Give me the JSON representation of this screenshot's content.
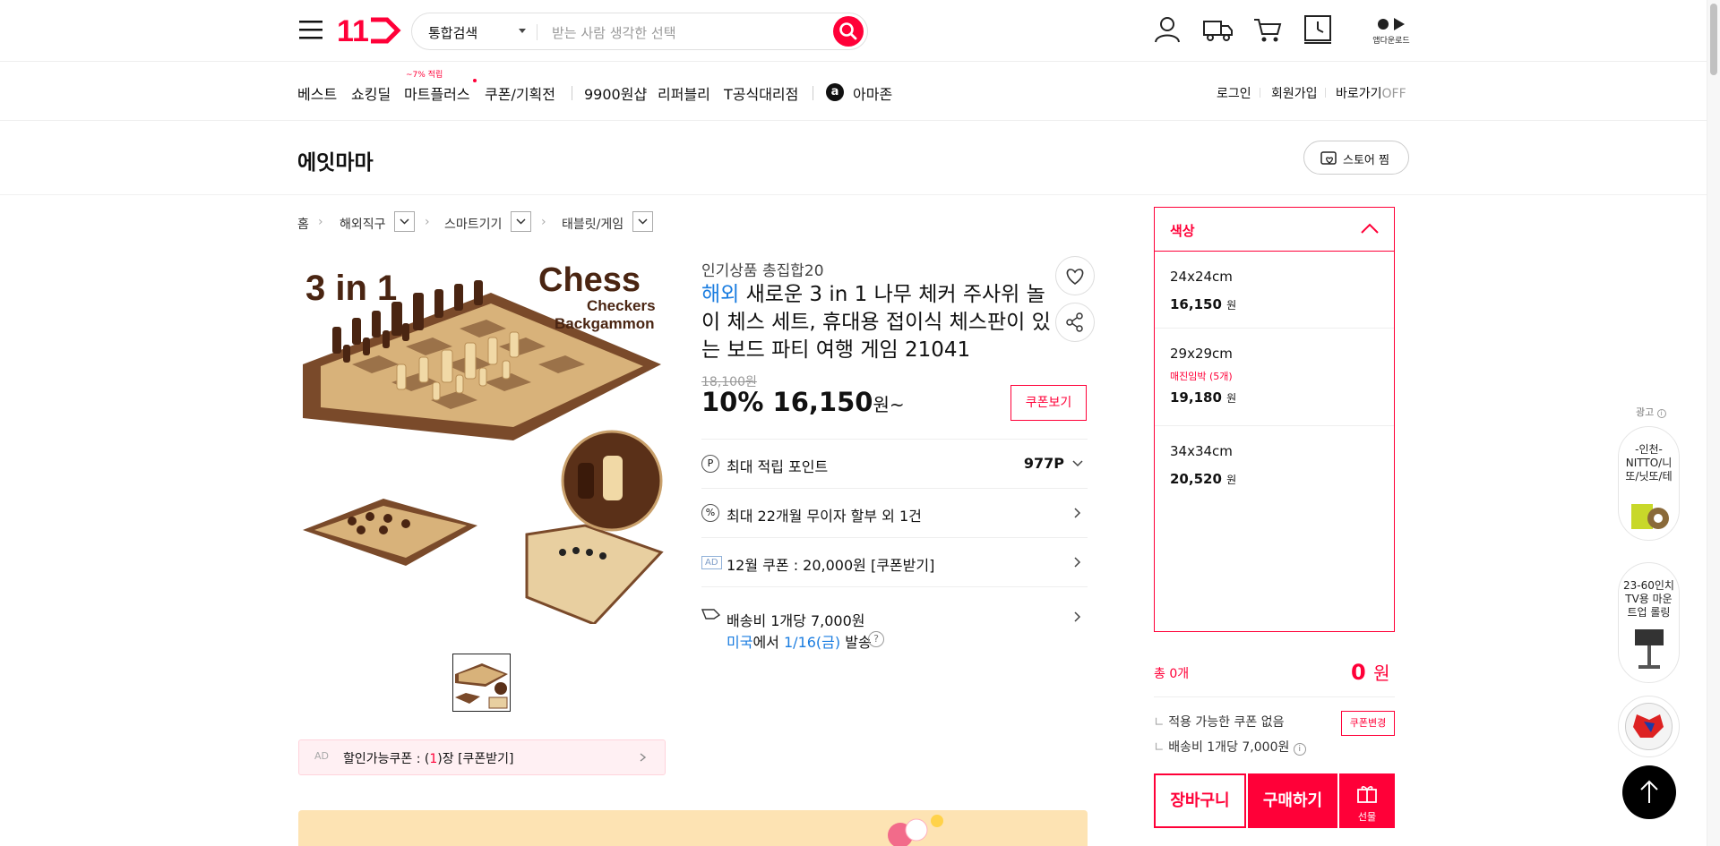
{
  "header": {
    "logo": "11",
    "search_category": "통합검색",
    "search_placeholder": "받는 사람 생각한 선택",
    "app_download": "앱다운로드"
  },
  "nav": {
    "items": [
      "베스트",
      "쇼킹딜",
      "마트플러스",
      "쿠폰/기획전",
      "9900원샵",
      "리퍼블리",
      "T공식대리점",
      "아마존"
    ],
    "mart_badge": "~7% 적립",
    "login": "로그인",
    "signup": "회원가입",
    "shortcut": "바로가기",
    "shortcut_state": "OFF"
  },
  "store": {
    "name": "에잇마마",
    "follow_label": "스토어 찜"
  },
  "breadcrumb": [
    "홈",
    "해외직구",
    "스마트기기",
    "태블릿/게임"
  ],
  "product": {
    "image_text_left": "3 in 1",
    "image_text_right": "Chess",
    "image_text_sub1": "Checkers",
    "image_text_sub2": "Backgammon",
    "subtitle": "인기상품 총집합20",
    "overseas_tag": "해외",
    "title": "새로운 3 in 1 나무 체커 주사위 놀이 체스 세트, 휴대용 접이식 체스판이 있는 보드 파티 여행 게임 21041",
    "original_price": "18,100원",
    "discount": "10%",
    "price": "16,150",
    "price_unit": "원~",
    "coupon_button": "쿠폰보기",
    "points_label": "최대 적립 포인트",
    "points_value": "977P",
    "installment": "최대 22개월 무이자 할부 외 1건",
    "ad_coupon": "12월 쿠폰 : 20,000원 [쿠폰받기]",
    "shipping_fee": "배송비 1개당 7,000원",
    "ship_country": "미국",
    "ship_from_text": "에서",
    "ship_date": "1/16(금)",
    "ship_suffix": "발송",
    "discount_coupon_ad": "AD",
    "discount_coupon_label": "할인가능쿠폰 : (",
    "discount_coupon_count": "1",
    "discount_coupon_tail": ")장 [쿠폰받기]"
  },
  "options": {
    "header": "색상",
    "items": [
      {
        "name": "24x24cm",
        "price": "16,150",
        "unit": "원",
        "note": ""
      },
      {
        "name": "29x29cm",
        "price": "19,180",
        "unit": "원",
        "note": "매진임박 (5개)"
      },
      {
        "name": "34x34cm",
        "price": "20,520",
        "unit": "원",
        "note": ""
      }
    ]
  },
  "order": {
    "total_count": "총 0개",
    "total_price": "0",
    "total_unit": "원",
    "no_coupon": "적용 가능한 쿠폰 없음",
    "coupon_change": "쿠폰변경",
    "shipping": "배송비 1개당 7,000원",
    "cart": "장바구니",
    "buy": "구매하기",
    "gift": "선물"
  },
  "ads_sidebar": {
    "label": "광고",
    "items": [
      "-인천-NITTO/니또/닛또/테",
      "23-60인치 TV용 마운트업 롤링"
    ]
  },
  "colors": {
    "accent": "#ff0038",
    "link_blue": "#1b7de0"
  }
}
